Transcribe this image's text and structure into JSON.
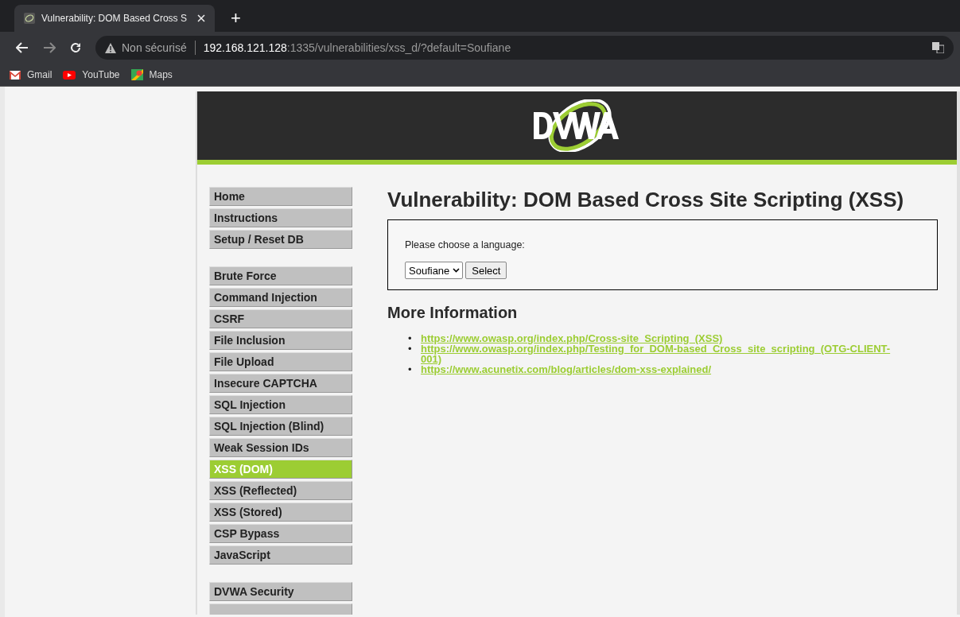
{
  "browser": {
    "tab": {
      "title": "Vulnerability: DOM Based Cross S",
      "selected": true
    },
    "new_tab": "+",
    "security": "Non sécurisé",
    "url_host": "192.168.121.128",
    "url_rest": ":1335/vulnerabilities/xss_d/?default=Soufiane",
    "bookmarks": [
      {
        "label": "Gmail",
        "kind": "gmail"
      },
      {
        "label": "YouTube",
        "kind": "youtube"
      },
      {
        "label": "Maps",
        "kind": "maps"
      }
    ]
  },
  "page": {
    "title": "Vulnerability: DOM Based Cross Site Scripting (XSS)",
    "menu": [
      {
        "items": [
          {
            "label": "Home",
            "selected": false
          },
          {
            "label": "Instructions",
            "selected": false
          },
          {
            "label": "Setup / Reset DB",
            "selected": false
          }
        ]
      },
      {
        "items": [
          {
            "label": "Brute Force",
            "selected": false
          },
          {
            "label": "Command Injection",
            "selected": false
          },
          {
            "label": "CSRF",
            "selected": false
          },
          {
            "label": "File Inclusion",
            "selected": false
          },
          {
            "label": "File Upload",
            "selected": false
          },
          {
            "label": "Insecure CAPTCHA",
            "selected": false
          },
          {
            "label": "SQL Injection",
            "selected": false
          },
          {
            "label": "SQL Injection (Blind)",
            "selected": false
          },
          {
            "label": "Weak Session IDs",
            "selected": false
          },
          {
            "label": "XSS (DOM)",
            "selected": true
          },
          {
            "label": "XSS (Reflected)",
            "selected": false
          },
          {
            "label": "XSS (Stored)",
            "selected": false
          },
          {
            "label": "CSP Bypass",
            "selected": false
          },
          {
            "label": "JavaScript",
            "selected": false
          }
        ]
      },
      {
        "items": [
          {
            "label": "DVWA Security",
            "selected": false
          },
          {
            "kind": "clipped",
            "selected": false
          }
        ]
      }
    ],
    "form": {
      "label": "Please choose a language:",
      "select_value": "Soufiane",
      "button": "Select"
    },
    "more_info": {
      "heading": "More Information",
      "links": [
        {
          "marker": "•",
          "url": "https://www.owasp.org/index.php/Cross-site_Scripting_(XSS)"
        },
        {
          "marker": "•",
          "url": "https://www.owasp.org/index.php/Testing_for_DOM-based_Cross_site_scripting_(OTG-CLIENT-001)"
        },
        {
          "marker": "•",
          "url": "https://www.acunetix.com/blog/articles/dom-xss-explained/"
        }
      ]
    }
  }
}
